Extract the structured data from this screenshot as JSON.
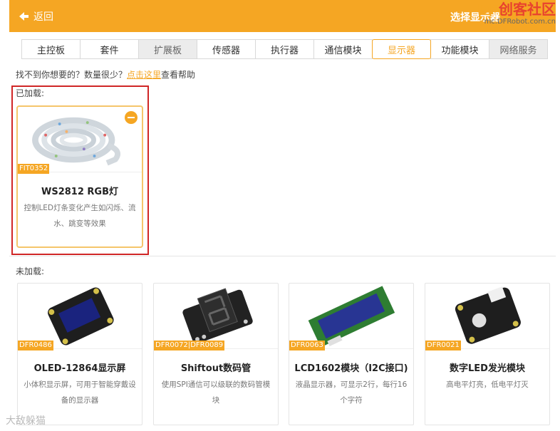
{
  "header": {
    "back_label": "返回",
    "title": "选择显示器",
    "watermark_df": "DF",
    "watermark_brand": "创客社区",
    "watermark_url": "mc.DFRobot.com.cn"
  },
  "tabs": [
    {
      "label": "主控板",
      "state": "normal"
    },
    {
      "label": "套件",
      "state": "normal"
    },
    {
      "label": "扩展板",
      "state": "disabled"
    },
    {
      "label": "传感器",
      "state": "normal"
    },
    {
      "label": "执行器",
      "state": "normal"
    },
    {
      "label": "通信模块",
      "state": "normal"
    },
    {
      "label": "显示器",
      "state": "active"
    },
    {
      "label": "功能模块",
      "state": "normal"
    },
    {
      "label": "网络服务",
      "state": "disabled"
    }
  ],
  "help": {
    "prefix": "找不到你想要的？数量很少？",
    "link": "点击这里",
    "suffix": "查看帮助"
  },
  "loaded": {
    "label": "已加载:",
    "items": [
      {
        "sku": "FIT0352",
        "title": "WS2812 RGB灯",
        "desc": "控制LED灯条变化产生如闪烁、流水、跳变等效果"
      }
    ]
  },
  "unloaded": {
    "label": "未加载:",
    "items": [
      {
        "sku": "DFR0486",
        "title": "OLED-12864显示屏",
        "desc": "小体积显示屏，可用于智能穿戴设备的显示器"
      },
      {
        "sku": "DFR0072|DFR0089",
        "title": "Shiftout数码管",
        "desc": "使用SPI通信可以级联的数码管模块"
      },
      {
        "sku": "DFR0063",
        "title": "LCD1602模块（I2C接口)",
        "desc": "液晶显示器，可显示2行，每行16个字符"
      },
      {
        "sku": "DFR0021",
        "title": "数字LED发光模块",
        "desc": "高电平灯亮，低电平灯灭"
      }
    ]
  },
  "footer_watermark": "大敌躲猫",
  "colors": {
    "accent": "#f5a623",
    "highlight": "#d02626"
  }
}
